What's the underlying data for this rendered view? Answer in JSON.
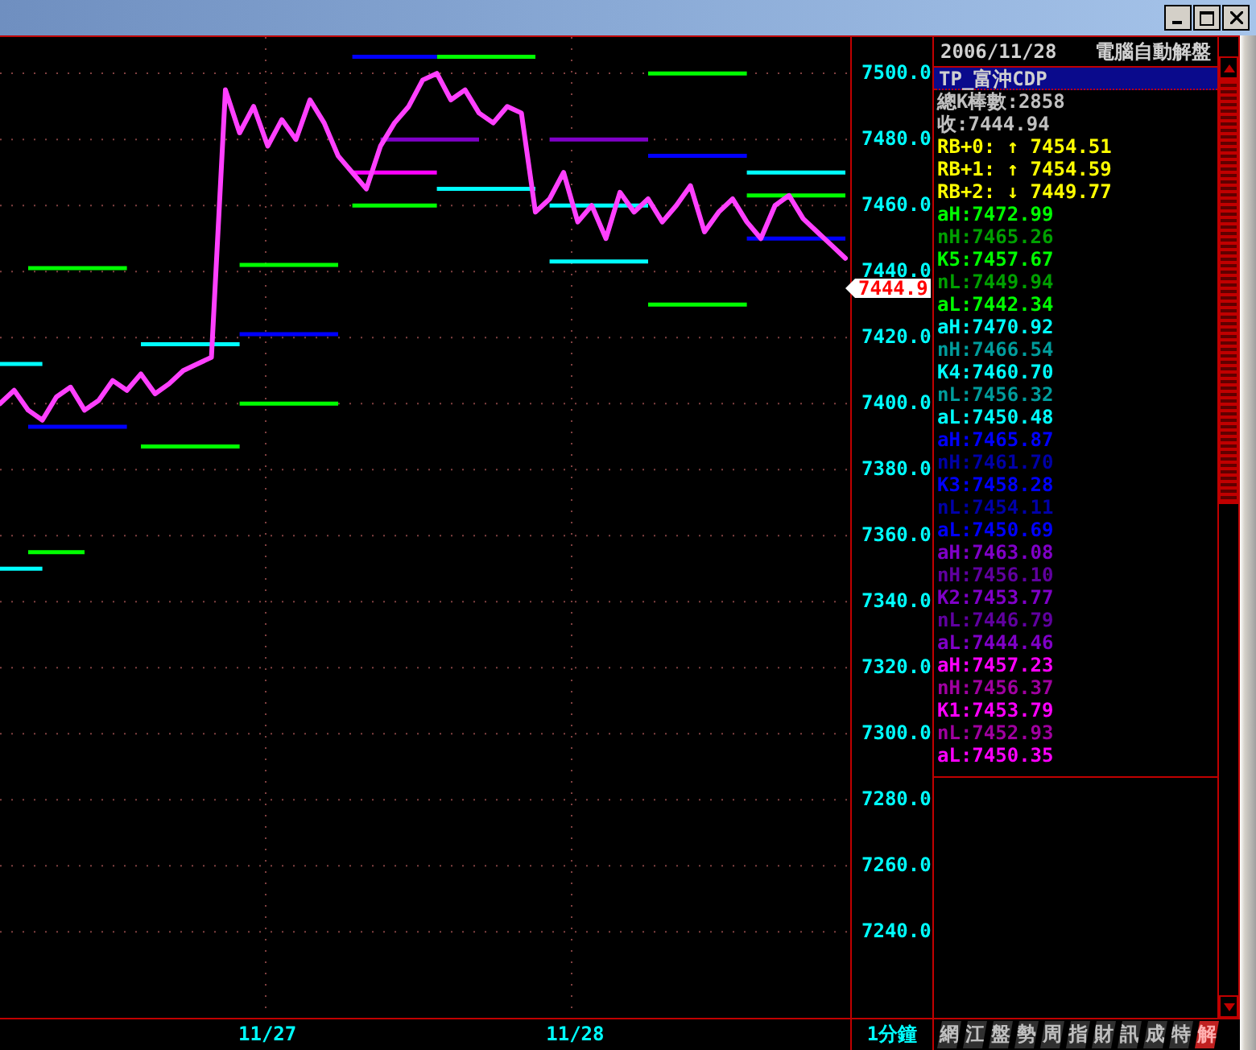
{
  "chart": {
    "chart_data": {
      "type": "line",
      "ylim": [
        7214,
        7511
      ],
      "grid": true,
      "yticks": [
        {
          "value": 7500,
          "label": "7500.0"
        },
        {
          "value": 7480,
          "label": "7480.0"
        },
        {
          "value": 7460,
          "label": "7460.0"
        },
        {
          "value": 7440,
          "label": "7440.0"
        },
        {
          "value": 7420,
          "label": "7420.0"
        },
        {
          "value": 7400,
          "label": "7400.0"
        },
        {
          "value": 7380,
          "label": "7380.0"
        },
        {
          "value": 7360,
          "label": "7360.0"
        },
        {
          "value": 7340,
          "label": "7340.0"
        },
        {
          "value": 7320,
          "label": "7320.0"
        },
        {
          "value": 7300,
          "label": "7300.0"
        },
        {
          "value": 7280,
          "label": "7280.0"
        },
        {
          "value": 7260,
          "label": "7260.0"
        },
        {
          "value": 7240,
          "label": "7240.0"
        }
      ],
      "series": [
        {
          "color": "#00ff00",
          "values": [
            null,
            null,
            7355,
            7355,
            7355,
            7355,
            7355,
            null,
            null,
            null,
            7387,
            7387,
            7387,
            7387,
            7387,
            7387,
            7387,
            7387,
            null,
            null,
            null,
            null,
            null,
            null,
            null,
            7460,
            7460,
            7460,
            7460,
            7460,
            7460,
            7460,
            null,
            null,
            null,
            null,
            null,
            null,
            null,
            null,
            null,
            null,
            null,
            null,
            null,
            null,
            7500,
            7500,
            7500,
            7500,
            7500,
            7500,
            7500,
            7500,
            null,
            null,
            null,
            null,
            null,
            null,
            null
          ]
        },
        {
          "color": "#00ff00",
          "values": [
            null,
            null,
            7441,
            7441,
            7441,
            7441,
            7441,
            7441,
            7441,
            7441,
            null,
            null,
            null,
            null,
            null,
            null,
            null,
            7400,
            7400,
            7400,
            7400,
            7400,
            7400,
            7400,
            7400,
            null,
            null,
            null,
            null,
            null,
            null,
            7505,
            7505,
            7505,
            7505,
            7505,
            7505,
            7505,
            7505,
            null,
            null,
            null,
            null,
            null,
            null,
            null,
            7430,
            7430,
            7430,
            7430,
            7430,
            7430,
            7430,
            7430,
            null,
            null,
            null,
            null,
            null,
            null,
            null
          ]
        },
        {
          "color": "#00ff00",
          "values": [
            null,
            null,
            null,
            null,
            null,
            null,
            null,
            null,
            null,
            null,
            null,
            null,
            null,
            null,
            null,
            null,
            null,
            7442,
            7442,
            7442,
            7442,
            7442,
            7442,
            7442,
            7442,
            null,
            null,
            null,
            null,
            null,
            null,
            null,
            null,
            null,
            null,
            null,
            null,
            null,
            null,
            null,
            null,
            null,
            null,
            null,
            null,
            null,
            null,
            null,
            null,
            null,
            null,
            null,
            null,
            7463,
            7463,
            7463,
            7463,
            7463,
            7463,
            7463,
            7463
          ]
        },
        {
          "color": "#00ffff",
          "values": [
            7412,
            7412,
            7412,
            7412,
            null,
            null,
            null,
            null,
            null,
            null,
            7418,
            7418,
            7418,
            7418,
            7418,
            7418,
            7418,
            7418,
            null,
            null,
            null,
            null,
            null,
            null,
            null,
            null,
            null,
            null,
            null,
            null,
            null,
            7465,
            7465,
            7465,
            7465,
            7465,
            7465,
            7465,
            7465,
            null,
            null,
            null,
            null,
            null,
            null,
            null,
            null,
            null,
            null,
            null,
            null,
            null,
            null,
            7470,
            7470,
            7470,
            7470,
            7470,
            7470,
            7470,
            7470
          ]
        },
        {
          "color": "#00ffff",
          "values": [
            7350,
            7350,
            7350,
            7350,
            null,
            null,
            null,
            null,
            null,
            null,
            null,
            null,
            null,
            null,
            null,
            null,
            null,
            null,
            null,
            null,
            null,
            null,
            null,
            null,
            null,
            null,
            null,
            null,
            null,
            null,
            null,
            null,
            null,
            null,
            null,
            null,
            null,
            null,
            null,
            7460,
            7460,
            7460,
            7460,
            7460,
            7460,
            7460,
            7460,
            null,
            null,
            null,
            null,
            null,
            null,
            null,
            null,
            null,
            null,
            null,
            null,
            null,
            null
          ]
        },
        {
          "color": "#00ffff",
          "values": [
            null,
            null,
            null,
            null,
            null,
            null,
            null,
            null,
            null,
            null,
            null,
            null,
            null,
            null,
            null,
            null,
            null,
            null,
            null,
            null,
            null,
            null,
            null,
            null,
            null,
            null,
            null,
            null,
            null,
            null,
            null,
            null,
            null,
            null,
            null,
            null,
            null,
            null,
            null,
            7443,
            7443,
            7443,
            7443,
            7443,
            7443,
            7443,
            7443,
            null,
            null,
            null,
            null,
            null,
            null,
            null,
            null,
            null,
            null,
            null,
            null,
            null,
            null
          ]
        },
        {
          "color": "#0000ff",
          "values": [
            null,
            null,
            7393,
            7393,
            7393,
            7393,
            7393,
            7393,
            7393,
            7393,
            null,
            null,
            null,
            null,
            null,
            null,
            null,
            7421,
            7421,
            7421,
            7421,
            7421,
            7421,
            7421,
            7421,
            null,
            null,
            null,
            null,
            null,
            null,
            null,
            null,
            null,
            null,
            null,
            null,
            null,
            null,
            null,
            null,
            null,
            null,
            null,
            null,
            null,
            7475,
            7475,
            7475,
            7475,
            7475,
            7475,
            7475,
            7475,
            null,
            null,
            null,
            null,
            null,
            null,
            null
          ]
        },
        {
          "color": "#0000ff",
          "values": [
            null,
            null,
            null,
            null,
            null,
            null,
            null,
            null,
            null,
            null,
            null,
            null,
            null,
            null,
            null,
            null,
            null,
            null,
            null,
            null,
            null,
            null,
            null,
            null,
            null,
            7505,
            7505,
            7505,
            7505,
            7505,
            7505,
            7505,
            null,
            null,
            null,
            null,
            null,
            null,
            null,
            null,
            null,
            null,
            null,
            null,
            null,
            null,
            null,
            null,
            null,
            null,
            null,
            null,
            null,
            7450,
            7450,
            7450,
            7450,
            7450,
            7450,
            7450,
            7450
          ]
        },
        {
          "color": "#ff00ff",
          "values": [
            null,
            null,
            null,
            null,
            null,
            null,
            null,
            null,
            null,
            null,
            null,
            null,
            null,
            null,
            null,
            null,
            null,
            null,
            null,
            null,
            null,
            null,
            null,
            null,
            null,
            7470,
            7470,
            7470,
            7470,
            7470,
            7470,
            7470,
            null,
            null,
            null,
            null,
            null,
            null,
            null,
            null,
            null,
            null,
            null,
            null,
            null,
            null,
            null,
            null,
            null,
            null,
            null,
            null,
            null,
            null,
            null,
            null,
            null,
            null,
            null,
            null,
            null
          ]
        },
        {
          "color": "#8000c8",
          "values": [
            null,
            null,
            null,
            null,
            null,
            null,
            null,
            null,
            null,
            null,
            null,
            null,
            null,
            null,
            null,
            null,
            null,
            null,
            null,
            null,
            null,
            null,
            null,
            null,
            null,
            null,
            null,
            7480,
            7480,
            7480,
            7480,
            7480,
            7480,
            7480,
            7480,
            null,
            null,
            null,
            null,
            7480,
            7480,
            7480,
            7480,
            7480,
            7480,
            7480,
            7480,
            null,
            null,
            null,
            null,
            null,
            null,
            null,
            null,
            null,
            null,
            null,
            null,
            null,
            null
          ]
        },
        {
          "color": "#ff40ff",
          "values": [
            7400,
            7404,
            7398,
            7395,
            7402,
            7405,
            7398,
            7401,
            7407,
            7404,
            7409,
            7403,
            7406,
            7410,
            7412,
            7414,
            7495,
            7482,
            7490,
            7478,
            7486,
            7480,
            7492,
            7485,
            7475,
            7470,
            7465,
            7478,
            7485,
            7490,
            7498,
            7500,
            7492,
            7495,
            7488,
            7485,
            7490,
            7488,
            7458,
            7462,
            7470,
            7455,
            7460,
            7450,
            7464,
            7458,
            7462,
            7455,
            7460,
            7466,
            7452,
            7458,
            7462,
            7455,
            7450,
            7460,
            7463,
            7456,
            7452,
            7448,
            7444
          ]
        }
      ]
    },
    "price_tag": "7444.9",
    "dates": [
      "11/27",
      "11/28"
    ],
    "interval": "1分鐘"
  },
  "panel": {
    "date": "2006/11/28",
    "title": "電腦自動解盤",
    "symbol": "TP_富沖CDP",
    "rows": [
      {
        "kind": "info",
        "label": "總K棒數:",
        "value": "2858",
        "color": "#c0c0c0"
      },
      {
        "kind": "info",
        "label": "收:",
        "value": "7444.94",
        "color": "#c0c0c0"
      },
      {
        "kind": "arrow",
        "label": "RB+0:",
        "arrow": "↑",
        "value": "7454.51",
        "color": "#ffff00"
      },
      {
        "kind": "arrow",
        "label": "RB+1:",
        "arrow": "↑",
        "value": "7454.59",
        "color": "#ffff00"
      },
      {
        "kind": "arrow",
        "label": "RB+2:",
        "arrow": "↓",
        "value": "7449.77",
        "color": "#ffff00"
      },
      {
        "kind": "level",
        "label": "aH:",
        "value": "7472.99",
        "color": "#00ff00"
      },
      {
        "kind": "level",
        "label": "nH:",
        "value": "7465.26",
        "color": "#00a000"
      },
      {
        "kind": "level",
        "label": "K5:",
        "value": "7457.67",
        "color": "#00ff00"
      },
      {
        "kind": "level",
        "label": "nL:",
        "value": "7449.94",
        "color": "#00a000"
      },
      {
        "kind": "level",
        "label": "aL:",
        "value": "7442.34",
        "color": "#00ff00"
      },
      {
        "kind": "level",
        "label": "aH:",
        "value": "7470.92",
        "color": "#00ffff"
      },
      {
        "kind": "level",
        "label": "nH:",
        "value": "7466.54",
        "color": "#009c9c"
      },
      {
        "kind": "level",
        "label": "K4:",
        "value": "7460.70",
        "color": "#00ffff"
      },
      {
        "kind": "level",
        "label": "nL:",
        "value": "7456.32",
        "color": "#009c9c"
      },
      {
        "kind": "level",
        "label": "aL:",
        "value": "7450.48",
        "color": "#00ffff"
      },
      {
        "kind": "level",
        "label": "aH:",
        "value": "7465.87",
        "color": "#0000ff"
      },
      {
        "kind": "level",
        "label": "nH:",
        "value": "7461.70",
        "color": "#0000a8"
      },
      {
        "kind": "level",
        "label": "K3:",
        "value": "7458.28",
        "color": "#0000ff"
      },
      {
        "kind": "level",
        "label": "nL:",
        "value": "7454.11",
        "color": "#0000a8"
      },
      {
        "kind": "level",
        "label": "aL:",
        "value": "7450.69",
        "color": "#0000ff"
      },
      {
        "kind": "level",
        "label": "aH:",
        "value": "7463.08",
        "color": "#8000c8"
      },
      {
        "kind": "level",
        "label": "nH:",
        "value": "7456.10",
        "color": "#6000a0"
      },
      {
        "kind": "level",
        "label": "K2:",
        "value": "7453.77",
        "color": "#8000c8"
      },
      {
        "kind": "level",
        "label": "nL:",
        "value": "7446.79",
        "color": "#6000a0"
      },
      {
        "kind": "level",
        "label": "aL:",
        "value": "7444.46",
        "color": "#8000c8"
      },
      {
        "kind": "level",
        "label": "aH:",
        "value": "7457.23",
        "color": "#ff00ff"
      },
      {
        "kind": "level",
        "label": "nH:",
        "value": "7456.37",
        "color": "#a000a0"
      },
      {
        "kind": "level",
        "label": "K1:",
        "value": "7453.79",
        "color": "#ff00ff"
      },
      {
        "kind": "level",
        "label": "nL:",
        "value": "7452.93",
        "color": "#a000a0"
      },
      {
        "kind": "level",
        "label": "aL:",
        "value": "7450.35",
        "color": "#ff00ff"
      }
    ]
  },
  "tabs": [
    {
      "label": "網",
      "selected": false
    },
    {
      "label": "江",
      "selected": false
    },
    {
      "label": "盤",
      "selected": false
    },
    {
      "label": "勢",
      "selected": false
    },
    {
      "label": "周",
      "selected": false
    },
    {
      "label": "指",
      "selected": false
    },
    {
      "label": "財",
      "selected": false
    },
    {
      "label": "訊",
      "selected": false
    },
    {
      "label": "成",
      "selected": false
    },
    {
      "label": "特",
      "selected": false
    },
    {
      "label": "解",
      "selected": true
    }
  ]
}
